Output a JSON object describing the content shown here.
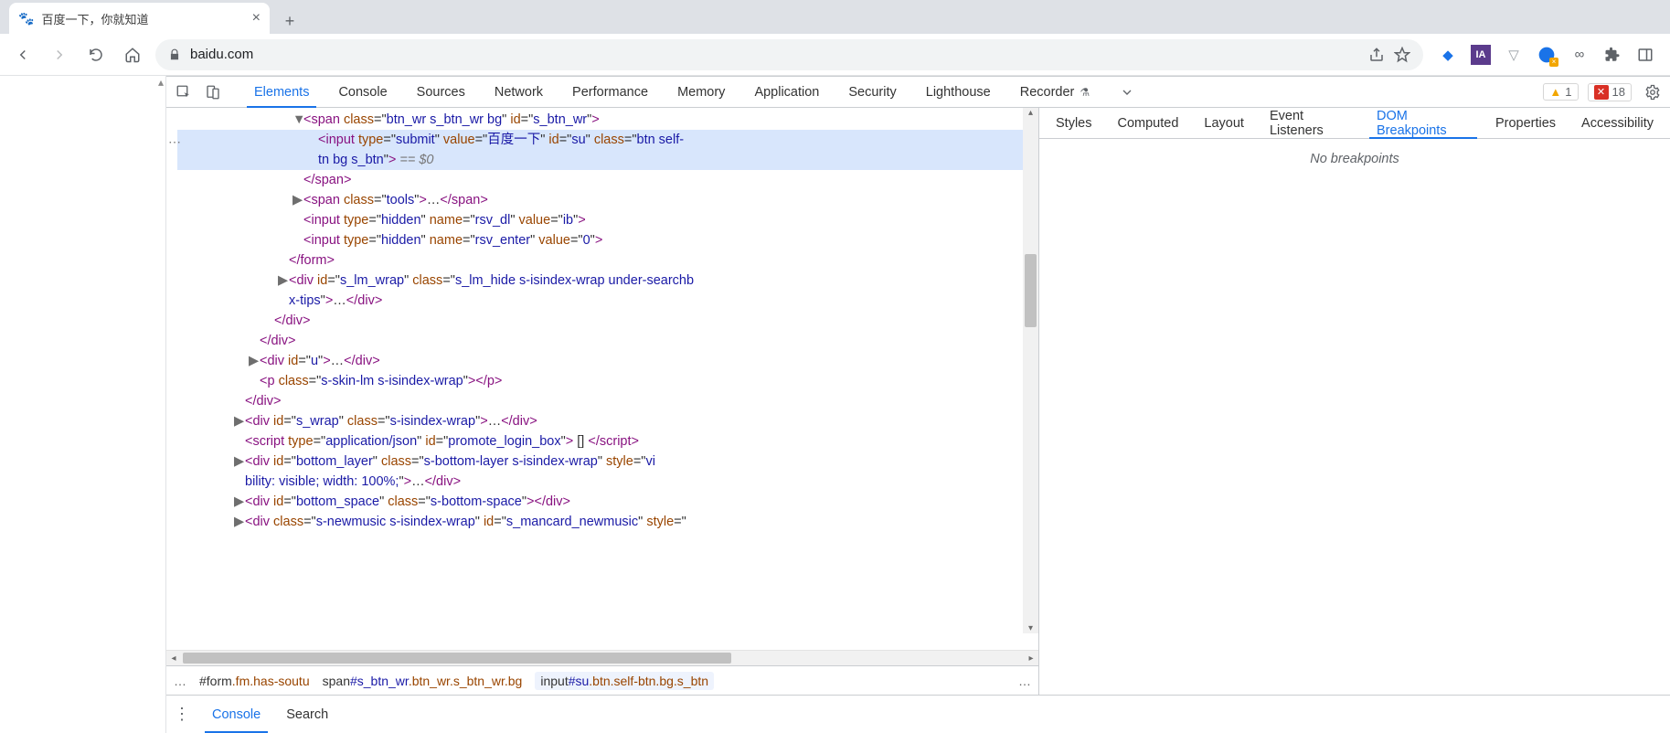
{
  "browser": {
    "tab_title": "百度一下，你就知道",
    "url": "baidu.com"
  },
  "devtools": {
    "tabs": [
      "Elements",
      "Console",
      "Sources",
      "Network",
      "Performance",
      "Memory",
      "Application",
      "Security",
      "Lighthouse",
      "Recorder"
    ],
    "active_tab": "Elements",
    "warnings": "1",
    "errors": "18",
    "side_tabs": [
      "Styles",
      "Computed",
      "Layout",
      "Event Listeners",
      "DOM Breakpoints",
      "Properties",
      "Accessibility"
    ],
    "side_active": "DOM Breakpoints",
    "side_message": "No breakpoints",
    "drawer_tabs": [
      "Console",
      "Search"
    ],
    "drawer_active": "Console"
  },
  "dom": {
    "lines": [
      {
        "indent": 7,
        "expand": "▼",
        "html": "<span class=\"t-tag\">&lt;span</span> <span class=\"t-attr\">class</span>=\"<span class=\"t-val\">btn_wr s_btn_wr bg</span>\" <span class=\"t-attr\">id</span>=\"<span class=\"t-val\">s_btn_wr</span>\"<span class=\"t-tag\">&gt;</span>"
      },
      {
        "indent": 8,
        "sel": true,
        "dots": true,
        "html": "<span class=\"t-tag\">&lt;input</span> <span class=\"t-attr\">type</span>=\"<span class=\"t-val\">submit</span>\" <span class=\"t-attr\">value</span>=\"<span class=\"t-val\">百度一下</span>\" <span class=\"t-attr\">id</span>=\"<span class=\"t-val\">su</span>\" <span class=\"t-attr\">class</span>=\"<span class=\"t-val\">btn self-</span>"
      },
      {
        "indent": 8,
        "sel": true,
        "cont": true,
        "html": "<span class=\"t-val\">tn bg s_btn</span>\"<span class=\"t-tag\">&gt;</span> <span class=\"t-comm\">== $0</span>"
      },
      {
        "indent": 7,
        "html": "<span class=\"t-tag\">&lt;/span&gt;</span>"
      },
      {
        "indent": 7,
        "expand": "▶",
        "html": "<span class=\"t-tag\">&lt;span</span> <span class=\"t-attr\">class</span>=\"<span class=\"t-val\">tools</span>\"<span class=\"t-tag\">&gt;</span>…<span class=\"t-tag\">&lt;/span&gt;</span>"
      },
      {
        "indent": 7,
        "html": "<span class=\"t-tag\">&lt;input</span> <span class=\"t-attr\">type</span>=\"<span class=\"t-val\">hidden</span>\" <span class=\"t-attr\">name</span>=\"<span class=\"t-val\">rsv_dl</span>\" <span class=\"t-attr\">value</span>=\"<span class=\"t-val\">ib</span>\"<span class=\"t-tag\">&gt;</span>"
      },
      {
        "indent": 7,
        "html": "<span class=\"t-tag\">&lt;input</span> <span class=\"t-attr\">type</span>=\"<span class=\"t-val\">hidden</span>\" <span class=\"t-attr\">name</span>=\"<span class=\"t-val\">rsv_enter</span>\" <span class=\"t-attr\">value</span>=\"<span class=\"t-val\">0</span>\"<span class=\"t-tag\">&gt;</span>"
      },
      {
        "indent": 6,
        "html": "<span class=\"t-tag\">&lt;/form&gt;</span>"
      },
      {
        "indent": 6,
        "expand": "▶",
        "html": "<span class=\"t-tag\">&lt;div</span> <span class=\"t-attr\">id</span>=\"<span class=\"t-val\">s_lm_wrap</span>\" <span class=\"t-attr\">class</span>=\"<span class=\"t-val\">s_lm_hide s-isindex-wrap under-searchb</span>"
      },
      {
        "indent": 6,
        "cont": true,
        "html": "<span class=\"t-val\">x-tips</span>\"<span class=\"t-tag\">&gt;</span>…<span class=\"t-tag\">&lt;/div&gt;</span>"
      },
      {
        "indent": 5,
        "html": "<span class=\"t-tag\">&lt;/div&gt;</span>"
      },
      {
        "indent": 4,
        "html": "<span class=\"t-tag\">&lt;/div&gt;</span>"
      },
      {
        "indent": 4,
        "expand": "▶",
        "html": "<span class=\"t-tag\">&lt;div</span> <span class=\"t-attr\">id</span>=\"<span class=\"t-val\">u</span>\"<span class=\"t-tag\">&gt;</span>…<span class=\"t-tag\">&lt;/div&gt;</span>"
      },
      {
        "indent": 4,
        "html": "<span class=\"t-tag\">&lt;p</span> <span class=\"t-attr\">class</span>=\"<span class=\"t-val\">s-skin-lm s-isindex-wrap</span>\"<span class=\"t-tag\">&gt;&lt;/p&gt;</span>"
      },
      {
        "indent": 3,
        "html": "<span class=\"t-tag\">&lt;/div&gt;</span>"
      },
      {
        "indent": 3,
        "expand": "▶",
        "html": "<span class=\"t-tag\">&lt;div</span> <span class=\"t-attr\">id</span>=\"<span class=\"t-val\">s_wrap</span>\" <span class=\"t-attr\">class</span>=\"<span class=\"t-val\">s-isindex-wrap</span>\"<span class=\"t-tag\">&gt;</span>…<span class=\"t-tag\">&lt;/div&gt;</span>"
      },
      {
        "indent": 3,
        "html": "<span class=\"t-tag\">&lt;script</span> <span class=\"t-attr\">type</span>=\"<span class=\"t-val\">application/json</span>\" <span class=\"t-attr\">id</span>=\"<span class=\"t-val\">promote_login_box</span>\"<span class=\"t-tag\">&gt;</span> [] <span class=\"t-tag\">&lt;/script&gt;</span>"
      },
      {
        "indent": 3,
        "expand": "▶",
        "html": "<span class=\"t-tag\">&lt;div</span> <span class=\"t-attr\">id</span>=\"<span class=\"t-val\">bottom_layer</span>\" <span class=\"t-attr\">class</span>=\"<span class=\"t-val\">s-bottom-layer s-isindex-wrap</span>\" <span class=\"t-attr\">style</span>=\"<span class=\"t-val\">vi</span>"
      },
      {
        "indent": 3,
        "cont": true,
        "html": "<span class=\"t-val\">bility: visible; width: 100%;</span>\"<span class=\"t-tag\">&gt;</span>…<span class=\"t-tag\">&lt;/div&gt;</span>"
      },
      {
        "indent": 3,
        "expand": "▶",
        "html": "<span class=\"t-tag\">&lt;div</span> <span class=\"t-attr\">id</span>=\"<span class=\"t-val\">bottom_space</span>\" <span class=\"t-attr\">class</span>=\"<span class=\"t-val\">s-bottom-space</span>\"<span class=\"t-tag\">&gt;&lt;/div&gt;</span>"
      },
      {
        "indent": 3,
        "expand": "▶",
        "html": "<span class=\"t-tag\">&lt;div</span> <span class=\"t-attr\">class</span>=\"<span class=\"t-val\">s-newmusic s-isindex-wrap</span>\" <span class=\"t-attr\">id</span>=\"<span class=\"t-val\">s_mancard_newmusic</span>\" <span class=\"t-attr\">style</span>=\"<span class=\"t-val\"></span>"
      }
    ]
  },
  "breadcrumbs": [
    {
      "tag": "#form",
      "cls": ".fm.has-soutu"
    },
    {
      "tag": "span",
      "id": "#s_btn_wr",
      "cls": ".btn_wr.s_btn_wr.bg"
    },
    {
      "tag": "input",
      "id": "#su",
      "cls": ".btn.self-btn.bg.s_btn",
      "active": true
    }
  ]
}
